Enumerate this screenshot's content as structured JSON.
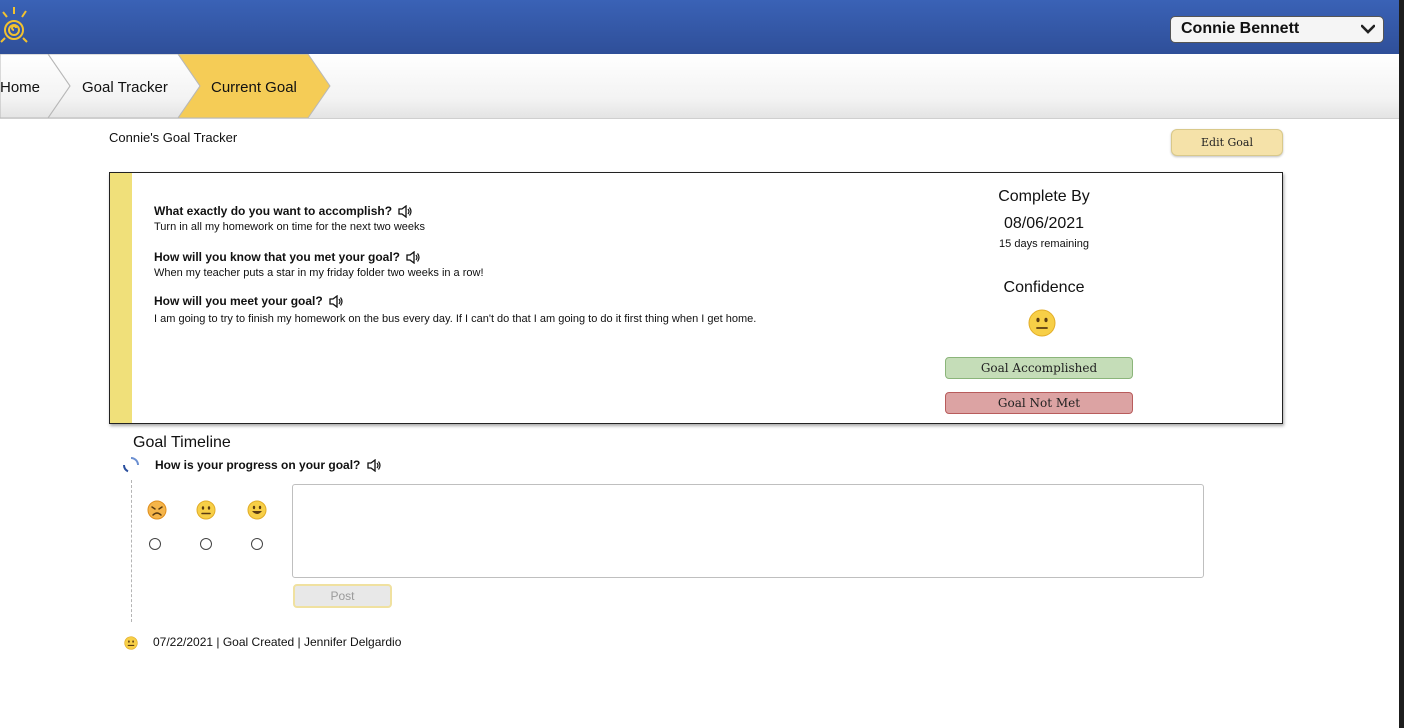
{
  "header": {
    "logo_icon": "sun-spiral-logo",
    "user_name": "Connie Bennett"
  },
  "breadcrumb": {
    "items": [
      "Home",
      "Goal Tracker",
      "Current Goal"
    ],
    "active_color": "#f5cc56"
  },
  "page": {
    "title": "Connie's Goal Tracker",
    "edit_label": "Edit Goal"
  },
  "goal": {
    "questions": [
      {
        "q": "What exactly do you want to accomplish?",
        "a": "Turn in all my homework on time for the next two weeks"
      },
      {
        "q": "How will you know that you met your goal?",
        "a": "When my teacher puts a star in my friday folder two weeks in a row!"
      },
      {
        "q": "How will you meet your goal?",
        "a": "I am going to try to finish my homework on the bus every day. If I can't do that I am going to do it first thing when I get home."
      }
    ],
    "complete_by_label": "Complete By",
    "complete_by_date": "08/06/2021",
    "days_remaining": "15 days remaining",
    "confidence_label": "Confidence",
    "confidence_icon": "neutral-face-emoji",
    "accomplished_label": "Goal Accomplished",
    "not_met_label": "Goal Not Met"
  },
  "timeline": {
    "title": "Goal Timeline",
    "progress_question": "How is your progress on your goal?",
    "mood_options": [
      "sad-face-emoji",
      "neutral-face-emoji",
      "happy-face-emoji"
    ],
    "post_label": "Post",
    "entries": [
      {
        "text": "07/22/2021 | Goal Created | Jennifer Delgardio",
        "icon": "neutral-face-emoji"
      }
    ]
  }
}
